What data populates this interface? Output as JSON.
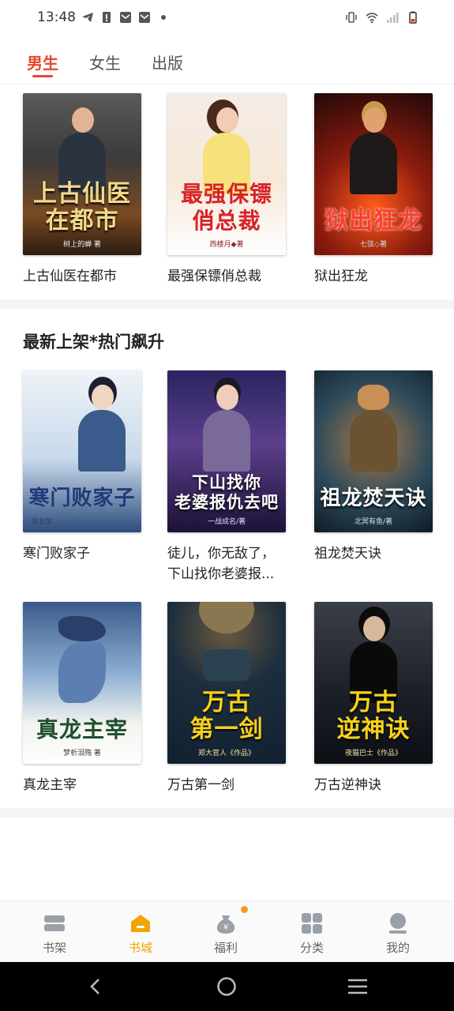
{
  "status_bar": {
    "time": "13:48"
  },
  "tabs": [
    {
      "label": "男生",
      "active": true
    },
    {
      "label": "女生",
      "active": false
    },
    {
      "label": "出版",
      "active": false
    }
  ],
  "row1": [
    {
      "title": "上古仙医在都市",
      "cover_text": "上古仙医\n在都市",
      "cover_author": "树上的蝉 著"
    },
    {
      "title": "最强保镖俏总裁",
      "cover_text": "最强保镖\n俏总裁",
      "cover_author": "西楼月◆著"
    },
    {
      "title": "狱出狂龙",
      "cover_text": "狱出狂龙",
      "cover_author": "七弦◇著"
    }
  ],
  "section": {
    "title": "最新上架*热门飙升"
  },
  "row2": [
    {
      "title": "寒门败家子",
      "cover_text": "寒门败家子",
      "cover_author": "寻北仪"
    },
    {
      "title": "徒儿，你无敌了，下山找你老婆报...",
      "cover_text": "下山找你\n老婆报仇去吧",
      "cover_author": "一战成名/著"
    },
    {
      "title": "祖龙焚天诀",
      "cover_text": "祖龙焚天诀",
      "cover_author": "北冥有鱼/著"
    }
  ],
  "row3": [
    {
      "title": "真龙主宰",
      "cover_text": "真龙主宰",
      "cover_author": "梦析泪殇 著"
    },
    {
      "title": "万古第一剑",
      "cover_text": "万古\n第一剑",
      "cover_author": "郑大官人《作品》"
    },
    {
      "title": "万古逆神诀",
      "cover_text": "万古\n逆神诀",
      "cover_author": "夜猫巴士《作品》"
    }
  ],
  "bottom_nav": [
    {
      "label": "书架",
      "icon": "bookshelf-icon",
      "active": false
    },
    {
      "label": "书城",
      "icon": "bookstore-icon",
      "active": true
    },
    {
      "label": "福利",
      "icon": "welfare-bag-icon",
      "active": false,
      "badge": true
    },
    {
      "label": "分类",
      "icon": "category-grid-icon",
      "active": false
    },
    {
      "label": "我的",
      "icon": "profile-icon",
      "active": false
    }
  ],
  "colors": {
    "accent_red": "#e8452f",
    "accent_orange": "#f3a400",
    "badge": "#f39a1f"
  }
}
